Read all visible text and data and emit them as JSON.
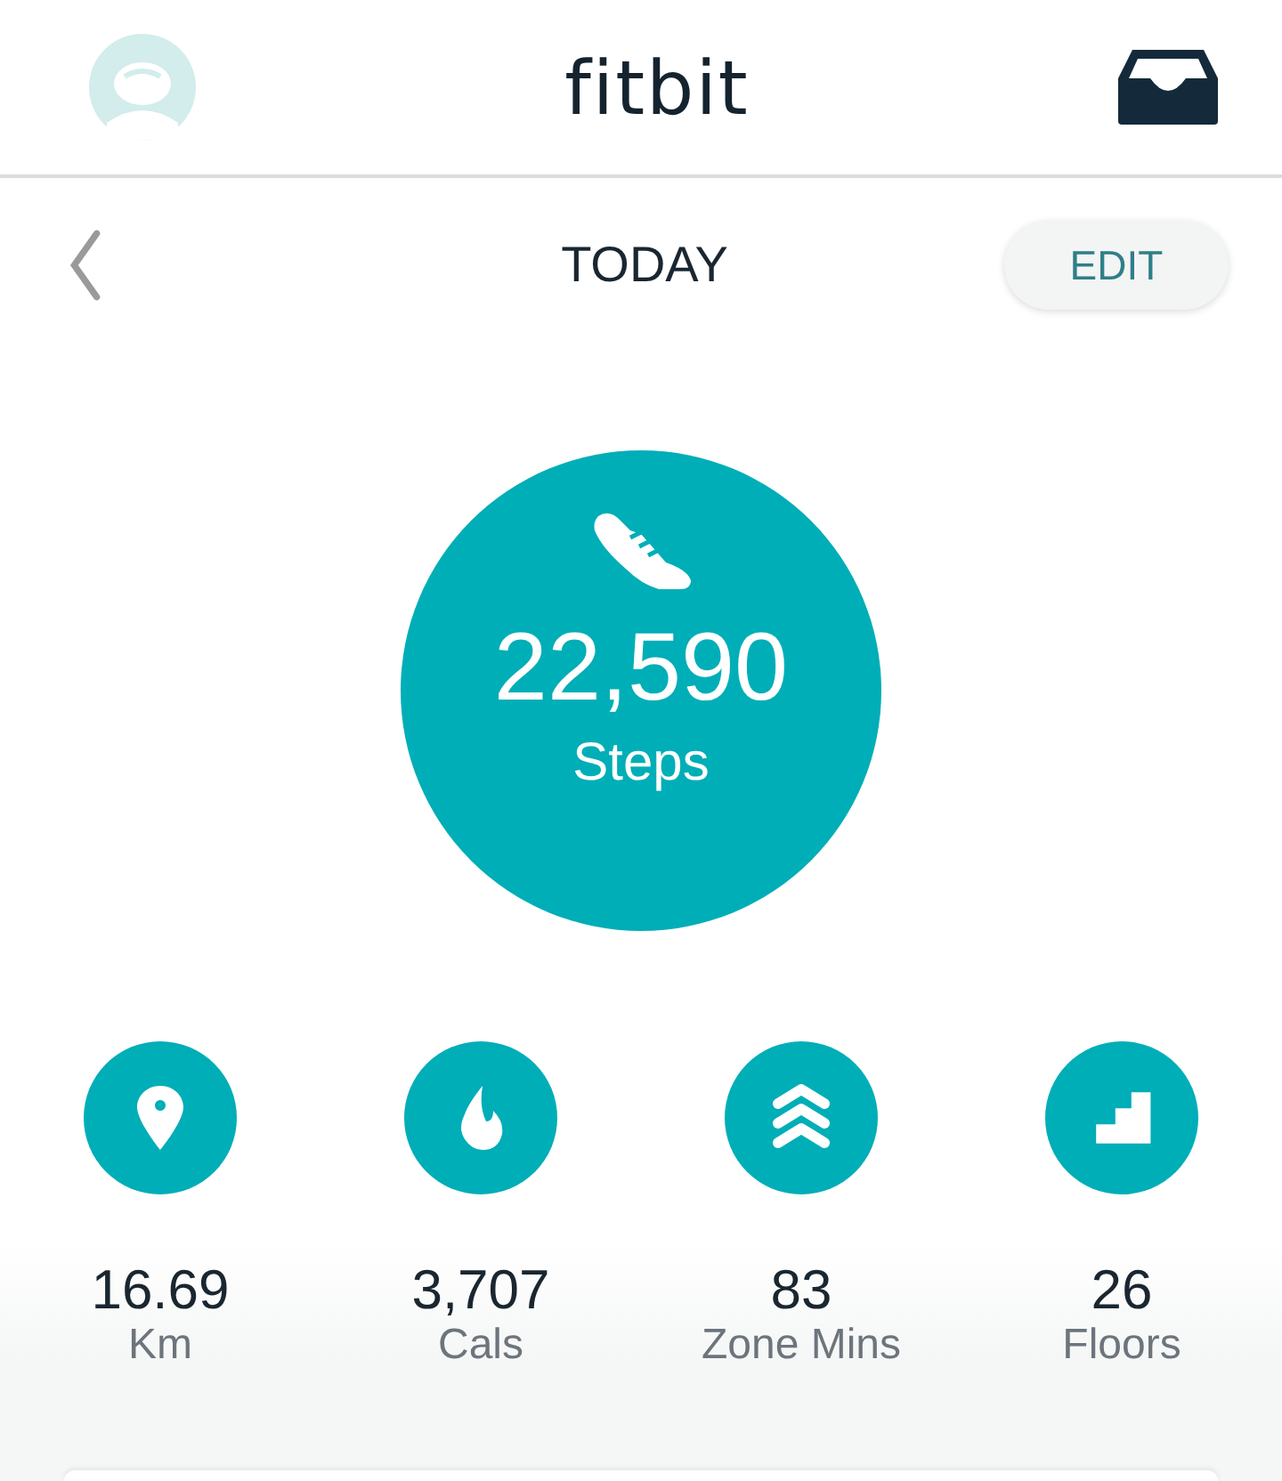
{
  "header": {
    "logo": "fitbit"
  },
  "nav": {
    "title": "TODAY",
    "edit_button": "EDIT"
  },
  "main_stat": {
    "value": "22,590",
    "label": "Steps"
  },
  "stats": [
    {
      "kind": "distance",
      "value": "16.69",
      "label": "Km"
    },
    {
      "kind": "calories",
      "value": "3,707",
      "label": "Cals"
    },
    {
      "kind": "zone",
      "value": "83",
      "label": "Zone Mins"
    },
    {
      "kind": "floors",
      "value": "26",
      "label": "Floors"
    }
  ]
}
